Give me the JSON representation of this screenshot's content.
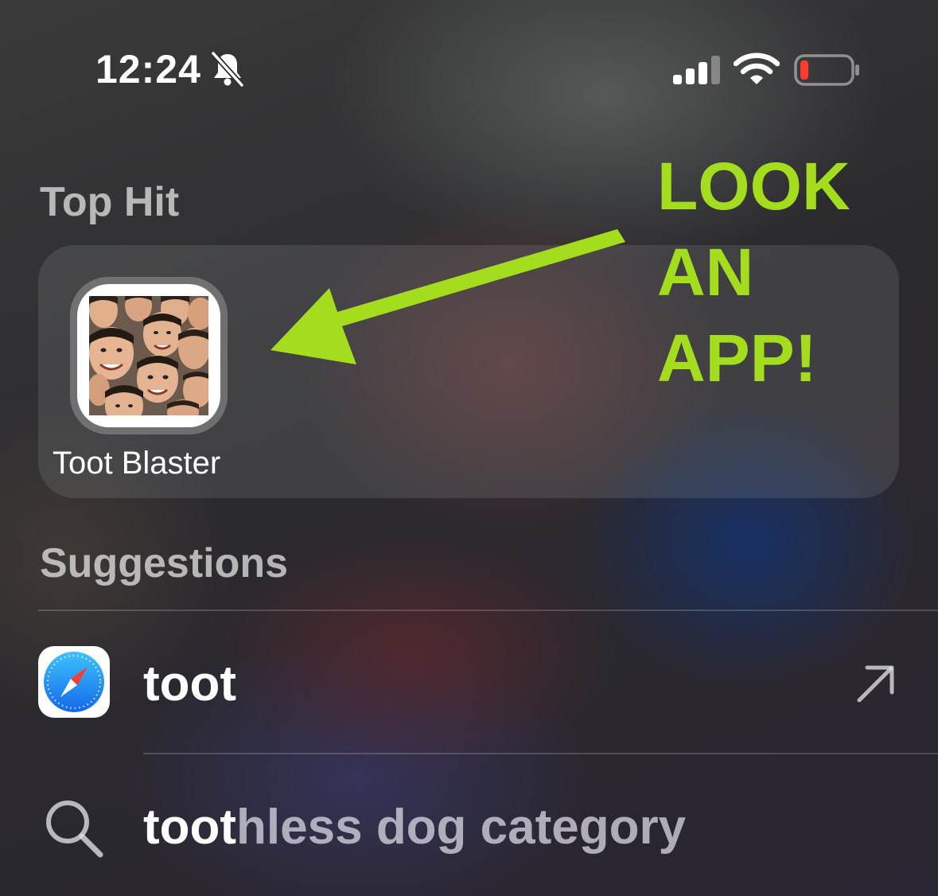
{
  "status_bar": {
    "time": "12:24",
    "silent_icon": "bell-slash-icon",
    "signal_icon": "cellular-signal-icon",
    "wifi_icon": "wifi-icon",
    "battery_icon": "battery-low-icon",
    "battery_color": "#ff3b30"
  },
  "top_hit": {
    "heading": "Top Hit",
    "app_name": "Toot Blaster",
    "app_icon": "app-icon-face-collage"
  },
  "annotation": {
    "lines": [
      "LOOK",
      "AN",
      "APP!"
    ],
    "color": "#a4dd1e",
    "arrow_icon": "arrow-left-icon"
  },
  "suggestions": {
    "heading": "Suggestions",
    "items": [
      {
        "icon": "safari-icon",
        "text": "toot",
        "action_icon": "arrow-up-right-icon"
      },
      {
        "icon": "search-icon",
        "typed": "toot",
        "completion": "hless dog category"
      }
    ]
  }
}
